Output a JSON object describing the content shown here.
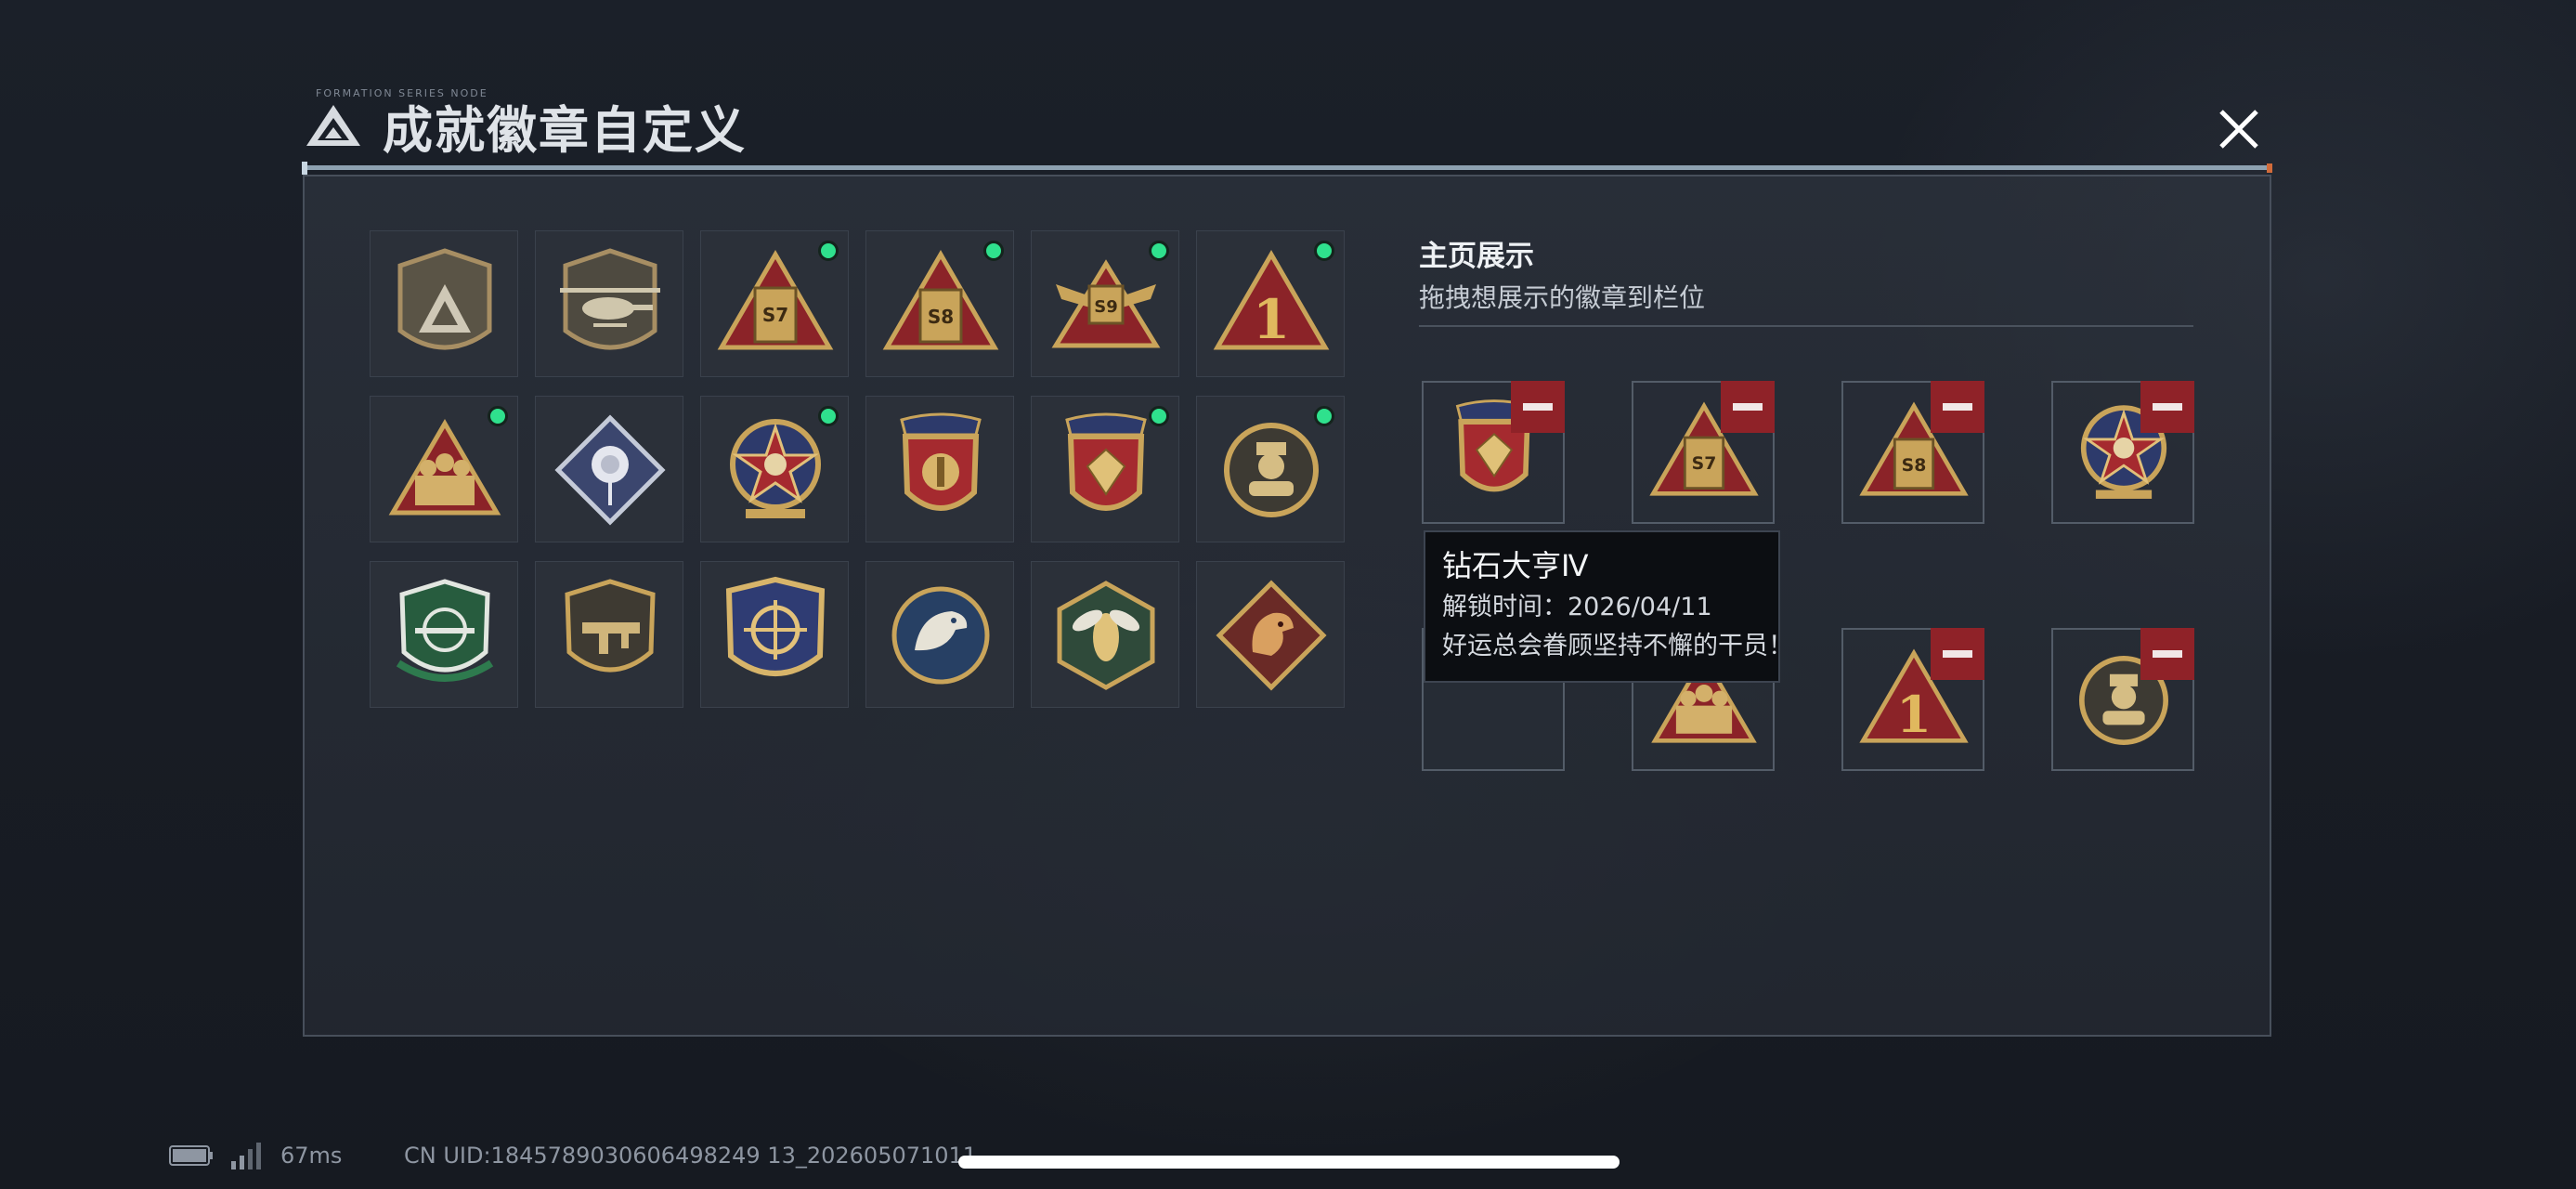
{
  "window": {
    "title": "成就徽章自定义",
    "title_decoration": "FORMATION SERIES NODE",
    "logo_icon": "triangle-logo-icon",
    "close_icon": "close-icon"
  },
  "badges": [
    {
      "name": "badge-shield-logo",
      "icon": "shield-logo-emblem",
      "unlocked_dot": false
    },
    {
      "name": "badge-helicopter",
      "icon": "helicopter-emblem",
      "unlocked_dot": false
    },
    {
      "name": "badge-s7",
      "icon": "s7-triangle-emblem",
      "label": "S7",
      "unlocked_dot": true
    },
    {
      "name": "badge-s8",
      "icon": "s8-triangle-emblem",
      "label": "S8",
      "unlocked_dot": true
    },
    {
      "name": "badge-s9",
      "icon": "s9-winged-emblem",
      "label": "S9",
      "unlocked_dot": true
    },
    {
      "name": "badge-number-1",
      "icon": "number-one-triangle-emblem",
      "label": "1",
      "unlocked_dot": true
    },
    {
      "name": "badge-soldiers",
      "icon": "soldiers-triangle-emblem",
      "unlocked_dot": true
    },
    {
      "name": "badge-rose",
      "icon": "rose-diamond-emblem",
      "unlocked_dot": false
    },
    {
      "name": "badge-star-skull",
      "icon": "star-skull-emblem",
      "unlocked_dot": true
    },
    {
      "name": "badge-gold-shield",
      "icon": "gold-shield-emblem",
      "unlocked_dot": true
    },
    {
      "name": "badge-diamond-shield",
      "icon": "diamond-shield-emblem",
      "unlocked_dot": true
    },
    {
      "name": "badge-agent-portrait",
      "icon": "agent-portrait-emblem",
      "unlocked_dot": true
    },
    {
      "name": "badge-green-rifle",
      "icon": "green-rifle-shield-emblem",
      "unlocked_dot": false
    },
    {
      "name": "badge-smg",
      "icon": "smg-shield-emblem",
      "unlocked_dot": false
    },
    {
      "name": "badge-crosshair",
      "icon": "crosshair-shield-emblem",
      "unlocked_dot": false
    },
    {
      "name": "badge-eagle",
      "icon": "eagle-emblem",
      "unlocked_dot": false
    },
    {
      "name": "badge-hornet",
      "icon": "hornet-hexagon-emblem",
      "unlocked_dot": false
    },
    {
      "name": "badge-dragon",
      "icon": "dragon-diamond-emblem",
      "unlocked_dot": false
    }
  ],
  "showcase": {
    "title": "主页展示",
    "subtitle": "拖拽想展示的徽章到栏位",
    "slots": [
      {
        "badge": "badge-diamond-shield",
        "label": ""
      },
      {
        "badge": "badge-s7",
        "label": "S7"
      },
      {
        "badge": "badge-s8",
        "label": "S8"
      },
      {
        "badge": "badge-star-skull",
        "label": ""
      },
      {
        "badge": "empty",
        "label": ""
      },
      {
        "badge": "badge-soldiers",
        "label": ""
      },
      {
        "badge": "badge-number-1",
        "label": "1"
      },
      {
        "badge": "badge-agent-portrait",
        "label": ""
      }
    ],
    "remove_icon": "remove-icon"
  },
  "tooltip": {
    "title": "钻石大亨Ⅳ",
    "unlock_time": "解锁时间：2026/04/11",
    "description": "好运总会眷顾坚持不懈的干员！"
  },
  "status": {
    "latency": "67ms",
    "uid": "CN UID:1845789030606498249 13_202605071011",
    "battery_icon": "battery-icon",
    "signal_icon": "signal-icon"
  },
  "colors": {
    "gold": "#c9a45a",
    "green_dot": "#2fe18d",
    "remove_red": "#8f2228",
    "panel_border": "#474f5b"
  }
}
